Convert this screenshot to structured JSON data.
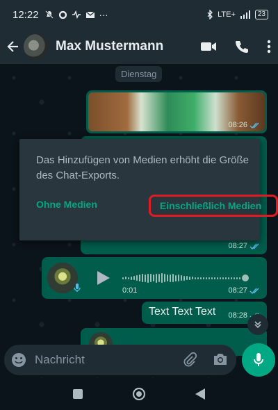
{
  "status_bar": {
    "time": "12:22",
    "battery": "23",
    "network": "LTE+"
  },
  "header": {
    "contact_name": "Max Mustermann"
  },
  "chat": {
    "date_chip": "Dienstag",
    "messages": [
      {
        "type": "image",
        "time": "08:26"
      },
      {
        "type": "hidden",
        "time": "08:27"
      },
      {
        "type": "voice",
        "duration": "0:01",
        "time": "08:27"
      },
      {
        "type": "text",
        "text": "Text Text Text",
        "time": "08:28"
      }
    ]
  },
  "dialog": {
    "message": "Das Hinzufügen von Medien erhöht die Größe des Chat-Exports.",
    "button_without": "Ohne Medien",
    "button_with": "Einschließlich Medien"
  },
  "input": {
    "placeholder": "Nachricht"
  },
  "colors": {
    "accent": "#00a884",
    "bubble_out": "#005c4b",
    "highlight": "#e01b24",
    "dialog_bg": "#29363d"
  },
  "icons": [
    "back-arrow-icon",
    "video-call-icon",
    "phone-icon",
    "more-vert-icon",
    "play-icon",
    "mic-icon",
    "emoji-icon",
    "attach-icon",
    "camera-icon",
    "chevron-down-icon",
    "nav-square-icon",
    "nav-circle-icon",
    "nav-back-icon"
  ]
}
